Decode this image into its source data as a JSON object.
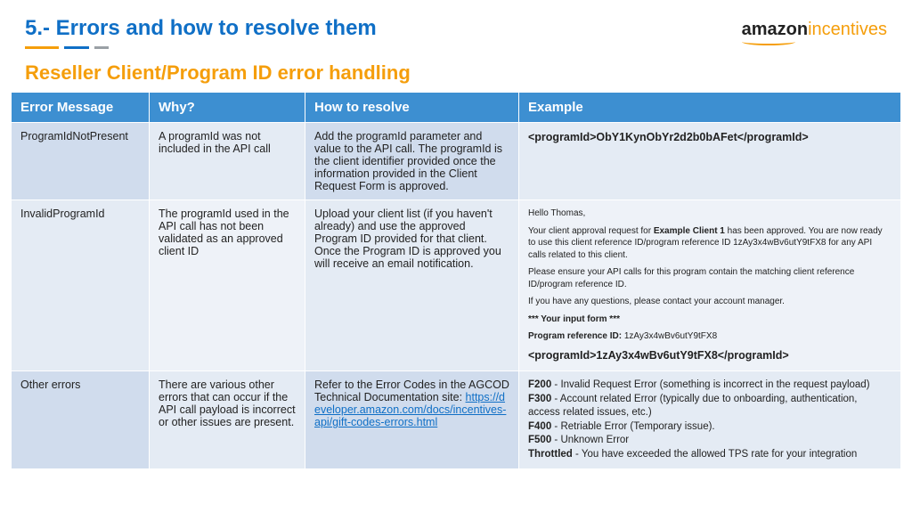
{
  "header": {
    "title": "5.- Errors and how to resolve them",
    "logo_main": "amazon",
    "logo_suffix": "incentives"
  },
  "subtitle": "Reseller Client/Program ID error handling",
  "table": {
    "headers": [
      "Error Message",
      "Why?",
      "How to resolve",
      "Example"
    ],
    "rows": [
      {
        "msg": "ProgramIdNotPresent",
        "why": "A programId was not included in the API call",
        "how": "Add the programId parameter and value to the API call. The programId is the client identifier provided once the information provided in the Client Request Form is approved.",
        "example_code": "<programId>ObY1KynObYr2d2b0bAFet</programId>"
      },
      {
        "msg": "InvalidProgramId",
        "why": "The programId used in the API call has not been validated as an approved client ID",
        "how": "Upload your client list (if you haven't already) and use the approved Program ID provided for that client. Once the Program ID is approved you will receive an email notification.",
        "email": {
          "greeting": "Hello Thomas,",
          "line1a": "Your client approval request for ",
          "client": "Example Client 1",
          "line1b": " has been approved. You are now ready to use this client reference ID/program reference ID 1zAy3x4wBv6utY9tFX8 for any API calls related to this client.",
          "line2": "Please ensure your API calls for this program contain the matching client reference ID/program reference ID.",
          "line3": "If you have any questions, please contact your account manager.",
          "input_hdr": "*** Your input form ***",
          "ref_label": "Program reference ID: ",
          "ref_value": "1zAy3x4wBv6utY9tFX8"
        },
        "example_code": "<programId>1zAy3x4wBv6utY9tFX8</programId>"
      },
      {
        "msg": "Other errors",
        "why": "There are various other errors that can occur if the API call payload is incorrect or other issues are present.",
        "how_prefix": "Refer to the Error Codes in the AGCOD Technical Documentation site: ",
        "how_link": "https://developer.amazon.com/docs/incentives-api/gift-codes-errors.html",
        "codes": [
          {
            "c": "F200",
            "d": " - Invalid Request Error (something is incorrect in the request payload)"
          },
          {
            "c": "F300",
            "d": " - Account related Error (typically due to onboarding, authentication, access related issues, etc.)"
          },
          {
            "c": "F400",
            "d": " - Retriable Error (Temporary issue)."
          },
          {
            "c": "F500",
            "d": " - Unknown Error"
          },
          {
            "c": "Throttled",
            "d": " - You have exceeded the allowed TPS rate for your integration"
          }
        ]
      }
    ]
  }
}
